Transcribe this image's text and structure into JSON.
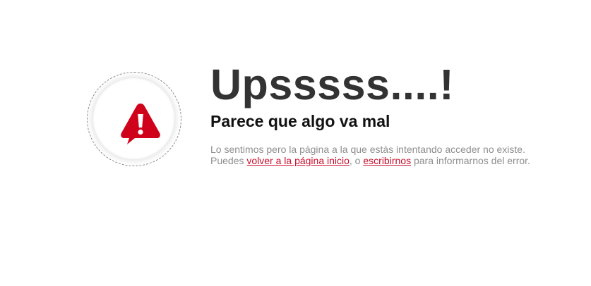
{
  "accent_color": "#d0021b",
  "icon": "warning-icon",
  "error": {
    "title": "Upsssss....!",
    "subtitle": "Parece que algo va mal",
    "message_part1": "Lo sentimos pero la página a la que estás intentando acceder no existe. Puedes ",
    "home_link": "volver a la página inicio",
    "message_part2": ", o ",
    "contact_link": "escribirnos",
    "message_part3": " para informarnos del error."
  }
}
